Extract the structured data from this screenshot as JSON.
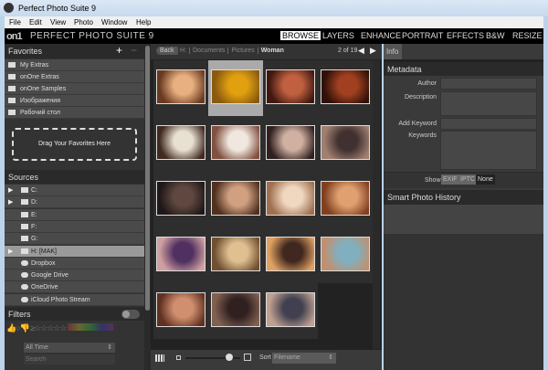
{
  "window": {
    "title": "Perfect Photo Suite 9"
  },
  "menu": [
    "File",
    "Edit",
    "View",
    "Photo",
    "Window",
    "Help"
  ],
  "brand": {
    "logo": "on1",
    "name": "PERFECT PHOTO SUITE 9"
  },
  "modules": [
    {
      "label": "BROWSE",
      "active": true
    },
    {
      "label": "LAYERS"
    },
    {
      "label": "ENHANCE"
    },
    {
      "label": "PORTRAIT"
    },
    {
      "label": "EFFECTS"
    },
    {
      "label": "B&W"
    },
    {
      "label": "RESIZE"
    }
  ],
  "favorites": {
    "title": "Favorites",
    "add": "+",
    "remove": "−",
    "items": [
      "My Extras",
      "onOne Extras",
      "onOne Samples",
      "Изображения",
      "Рабочий стол"
    ],
    "drop_hint": "Drag Your Favorites Here"
  },
  "sources": {
    "title": "Sources",
    "items": [
      {
        "label": "C:",
        "expand": true
      },
      {
        "label": "D:",
        "expand": true
      },
      {
        "label": "E:"
      },
      {
        "label": "F:"
      },
      {
        "label": "G:"
      },
      {
        "label": "H: [MAK]",
        "expand": true,
        "selected": true
      },
      {
        "label": "Dropbox"
      },
      {
        "label": "Google Drive"
      },
      {
        "label": "OneDrive"
      },
      {
        "label": "iCloud Photo Stream"
      }
    ]
  },
  "filters": {
    "title": "Filters",
    "time": "All Time",
    "search_placeholder": "Search"
  },
  "breadcrumb": {
    "back": "Back",
    "items": [
      "H:",
      "Documents",
      "Pictures",
      "Woman"
    ],
    "page": "2 of 19"
  },
  "photos": {
    "count": 19,
    "selected": 1,
    "colors": [
      [
        "#e8b080",
        "#6a3a20"
      ],
      [
        "#e0a010",
        "#8a5a10"
      ],
      [
        "#c06040",
        "#401810"
      ],
      [
        "#a04020",
        "#301008"
      ],
      [
        "#e8e0d0",
        "#402a20"
      ],
      [
        "#f0e8e0",
        "#805040"
      ],
      [
        "#d0b0a0",
        "#302020"
      ],
      [
        "#403030",
        "#a08070"
      ],
      [
        "#604840",
        "#201818"
      ],
      [
        "#d0a080",
        "#503020"
      ],
      [
        "#f0d8c0",
        "#a07050"
      ],
      [
        "#e0a070",
        "#804020"
      ],
      [
        "#503060",
        "#d0a0a0"
      ],
      [
        "#e0c090",
        "#705030"
      ],
      [
        "#402820",
        "#e0a060"
      ],
      [
        "#80b0c0",
        "#c09070"
      ],
      [
        "#d09070",
        "#603020"
      ],
      [
        "#302020",
        "#806050"
      ],
      [
        "#404050",
        "#c0a090"
      ]
    ]
  },
  "bottombar": {
    "sort_label": "Sort",
    "sort_value": "Filename",
    "zoom_level": 0.8
  },
  "info": {
    "tab": "Info",
    "metadata_title": "Metadata",
    "fields": [
      "Author",
      "Description",
      "Add Keyword",
      "Keywords"
    ],
    "show_label": "Show",
    "show_options": [
      "EXIF",
      "IPTC",
      "None"
    ],
    "history_title": "Smart Photo History"
  }
}
